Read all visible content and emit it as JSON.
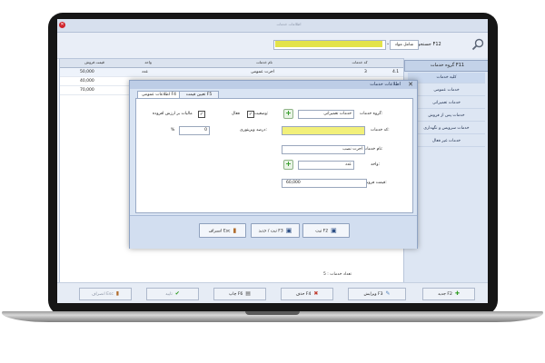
{
  "window": {
    "title": "اطلاعات خدمات"
  },
  "toolbar": {
    "search_label": "جستجو F12",
    "search_mode": "شامل مواد",
    "search_value": ""
  },
  "sidebar": {
    "header": "گروه خدمات F11",
    "items": [
      {
        "label": "کلیه خدمات"
      },
      {
        "label": "خدمات عمومی"
      },
      {
        "label": "خدمات تعمیراتی"
      },
      {
        "label": "خدمات پس از فروش"
      },
      {
        "label": "خدمات سرویس و نگهداری"
      },
      {
        "label": "خدمات غیر فعال"
      }
    ]
  },
  "grid": {
    "columns": [
      "کد خدمات",
      "نام خدمات",
      "واحد",
      "قیمت فروش"
    ],
    "rows": [
      {
        "index": "4.1",
        "code": "3",
        "name": "اجرت عمومی",
        "unit": "عدد",
        "price": "50,000"
      },
      {
        "index": "",
        "code": "",
        "name": "",
        "unit": "",
        "price": "40,000"
      },
      {
        "index": "",
        "code": "",
        "name": "",
        "unit": "",
        "price": "70,000"
      }
    ],
    "footer": "تعداد خدمات : 5"
  },
  "bottom_bar": {
    "new": "جدید F2",
    "edit": "ویرایش F3",
    "delete": "حذف F4",
    "print": "چاپ F6",
    "confirm": "تایید",
    "cancel": "انصراف Esc"
  },
  "modal": {
    "title": "اطلاعات خدمات",
    "tabs": [
      "اطلاعات عمومی F4",
      "تعیین قیمت F5"
    ],
    "fields": {
      "group_label": "گروه خدمات:",
      "group_value": "خدمات تعمیراتی",
      "code_label": "کد خدمات:",
      "code_value": "",
      "name_label": "نام خدمات:",
      "name_value": "اجرت نصب",
      "unit_label": "واحد:",
      "unit_value": "عدد",
      "price_label": "قیمت فروش:",
      "price_value": "60,000",
      "status_label": "وضعیت:",
      "status_active": "فعال",
      "status_active_checked": true,
      "vat_label": "مالیات بر ارزش افزوده",
      "vat_checked": true,
      "discount_label": "درصد ویزیتوری:",
      "discount_value": "0",
      "percent_sign": "%"
    },
    "buttons": {
      "save": "ثبت F2",
      "save_new": "ثبت / جدید F3",
      "cancel": "انصراف Esc"
    }
  },
  "colors": {
    "accent": "#bdcde6",
    "highlight": "#f2f07a",
    "plus_green": "#2f9c22"
  }
}
